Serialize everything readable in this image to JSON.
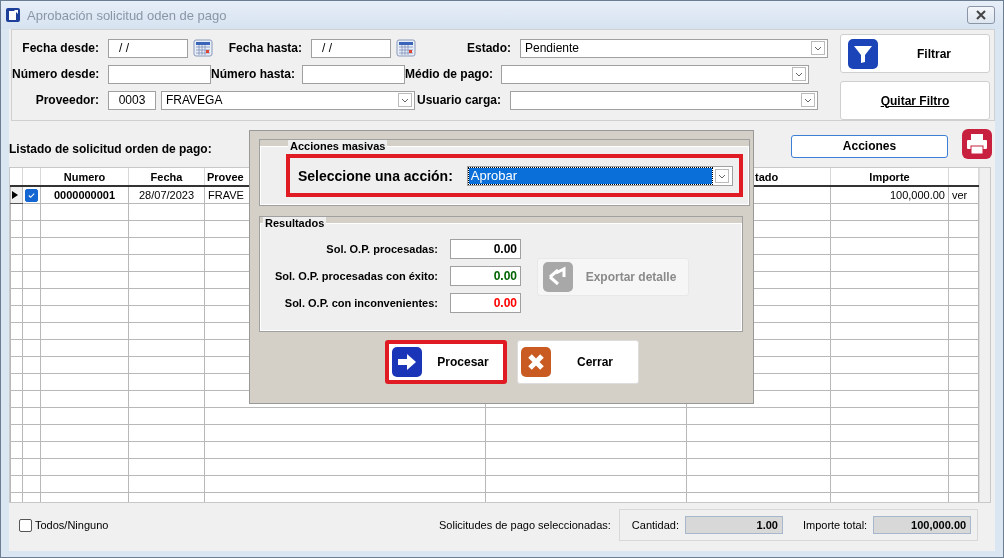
{
  "window": {
    "title": "Aprobación solicitud oden de pago"
  },
  "filters": {
    "fecha_desde": {
      "label": "Fecha desde:",
      "value": "/ /"
    },
    "fecha_hasta": {
      "label": "Fecha hasta:",
      "value": "/ /"
    },
    "estado": {
      "label": "Estado:",
      "value": "Pendiente"
    },
    "numero_desde": {
      "label": "Número desde:"
    },
    "numero_hasta": {
      "label": "Número hasta:"
    },
    "medio_pago": {
      "label": "Médio de pago:"
    },
    "proveedor": {
      "label": "Proveedor:",
      "code": "0003",
      "name": "FRAVEGA"
    },
    "usuario_carga": {
      "label": "Usuario carga:"
    },
    "filter_button": "Filtrar",
    "clear_button": "Quitar Filtro"
  },
  "list": {
    "title": "Listado de solicitud orden de pago:",
    "actions_button": "Acciones",
    "columns": [
      "Numero",
      "Fecha",
      "Provee",
      "tado",
      "Importe"
    ],
    "rows": [
      {
        "selected": true,
        "checked": true,
        "numero": "0000000001",
        "fecha": "28/07/2023",
        "proveedor": "FRAVE",
        "importe": "100,000.00",
        "link": "ver"
      }
    ]
  },
  "footer": {
    "all_label": "Todos/Ninguno",
    "all_checked": false,
    "selected_label": "Solicitudes de pago seleccionadas:",
    "cantidad_label": "Cantidad:",
    "cantidad": "1.00",
    "importe_label": "Importe total:",
    "importe": "100,000.00"
  },
  "dialog": {
    "actions_group": "Acciones masivas",
    "action_label": "Seleccione una acción:",
    "action_value": "Aprobar",
    "action_highlighted": true,
    "results_group": "Resultados",
    "results": [
      {
        "label": "Sol. O.P. procesadas:",
        "value": "0.00",
        "color": "#000000"
      },
      {
        "label": "Sol. O.P. procesadas con éxito:",
        "value": "0.00",
        "color": "#006400"
      },
      {
        "label": "Sol. O.P. con inconvenientes:",
        "value": "0.00",
        "color": "#ff0000"
      }
    ],
    "export_button": {
      "label": "Exportar detalle",
      "disabled": true
    },
    "process_button": {
      "label": "Procesar",
      "highlighted": true
    },
    "close_button": "Cerrar"
  }
}
